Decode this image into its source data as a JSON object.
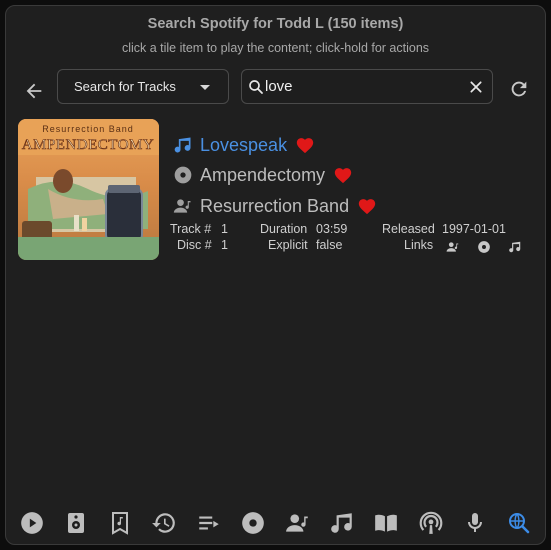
{
  "header": {
    "title": "Search Spotify for Todd L (150 items)",
    "subtitle": "click a tile item to play the content; click-hold for actions"
  },
  "toolbar": {
    "search_type": "Search for Tracks",
    "search_value": "love"
  },
  "result": {
    "track_name": "Lovespeak",
    "album_name": "Ampendectomy",
    "artist_name": "Resurrection Band",
    "cover_text_top": "Resurrection Band",
    "cover_text_title": "AMPENDECTOMY",
    "meta": {
      "track_label": "Track #",
      "track_value": "1",
      "disc_label": "Disc #",
      "disc_value": "1",
      "duration_label": "Duration",
      "duration_value": "03:59",
      "explicit_label": "Explicit",
      "explicit_value": "false",
      "released_label": "Released",
      "released_value": "1997-01-01",
      "links_label": "Links"
    }
  },
  "bottom_nav": [
    {
      "name": "player",
      "icon": "play-circle-icon"
    },
    {
      "name": "devices",
      "icon": "speaker-icon"
    },
    {
      "name": "bookmarks",
      "icon": "bookmark-music-icon"
    },
    {
      "name": "recent",
      "icon": "history-icon"
    },
    {
      "name": "playlists",
      "icon": "playlist-icon"
    },
    {
      "name": "albums",
      "icon": "album-icon"
    },
    {
      "name": "artists",
      "icon": "artist-icon"
    },
    {
      "name": "tracks",
      "icon": "music-note-icon"
    },
    {
      "name": "audiobooks",
      "icon": "book-icon"
    },
    {
      "name": "podcasts",
      "icon": "podcast-icon"
    },
    {
      "name": "episodes",
      "icon": "microphone-icon"
    },
    {
      "name": "search",
      "icon": "search-web-icon"
    }
  ],
  "colors": {
    "accent": "#4a90e2",
    "label": "#f08a2c",
    "heart": "#e01818",
    "active_nav": "#3c8ce7"
  }
}
